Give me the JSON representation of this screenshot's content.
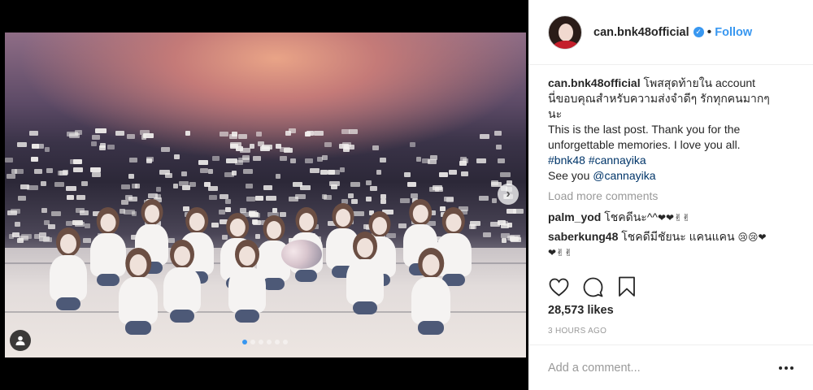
{
  "post": {
    "username": "can.bnk48official",
    "follow_label": "Follow",
    "separator": "•",
    "verified_icon": "verified-badge-icon"
  },
  "caption": {
    "username": "can.bnk48official",
    "line1": "โพสสุดท้ายใน account",
    "line2": "นี่ขอบคุณสำหรับความส่งจำดีๆ รักทุกคนมากๆ",
    "line3": "นะ",
    "line4": "This is the last post. Thank you for the",
    "line5": "unforgettable memories. I love you all.",
    "hashtag1": "#bnk48",
    "hashtag2": "#cannayika",
    "see_you": "See you",
    "mention": "@cannayika"
  },
  "load_more": "Load more comments",
  "comments": [
    {
      "user": "palm_yod",
      "text": "โชคดีนะ^^",
      "emoji": "❤❤✌✌"
    },
    {
      "user": "saberkung48",
      "text": "โชคดีมีชัยนะ แคนแคน",
      "emoji": "😢😢❤",
      "emoji2": "❤✌✌"
    }
  ],
  "likes": "28,573 likes",
  "timestamp": "3 HOURS AGO",
  "add_comment_placeholder": "Add a comment...",
  "carousel": {
    "slides": 6,
    "active_slide": 1
  },
  "colors": {
    "accent": "#3897f0",
    "hashtag": "#003569",
    "muted": "#999999",
    "text": "#262626"
  }
}
